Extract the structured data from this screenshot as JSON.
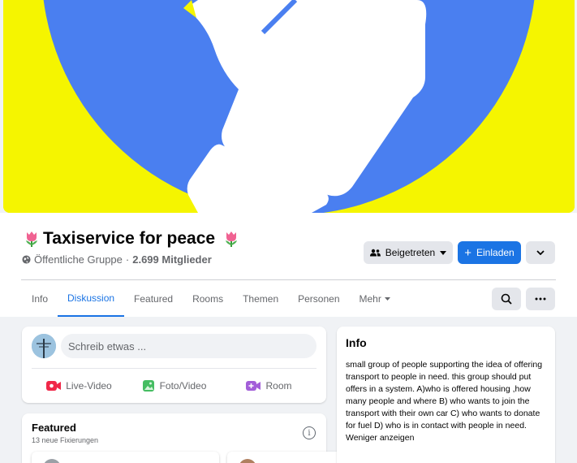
{
  "group": {
    "title": "Taxiservice for peace",
    "privacy": "Öffentliche Gruppe",
    "separator": " · ",
    "members": "2.699 Mitglieder"
  },
  "actions": {
    "joined_label": "Beigetreten",
    "invite_label": "Einladen"
  },
  "tabs": [
    {
      "label": "Info"
    },
    {
      "label": "Diskussion"
    },
    {
      "label": "Featured"
    },
    {
      "label": "Rooms"
    },
    {
      "label": "Themen"
    },
    {
      "label": "Personen"
    },
    {
      "label": "Mehr"
    }
  ],
  "composer": {
    "placeholder": "Schreib etwas ...",
    "actions": [
      {
        "label": "Live-Video",
        "icon": "live-video-icon",
        "color": "#f02849"
      },
      {
        "label": "Foto/Video",
        "icon": "photo-video-icon",
        "color": "#45bd62"
      },
      {
        "label": "Room",
        "icon": "room-icon",
        "color": "#a35fd9"
      }
    ]
  },
  "featured": {
    "title": "Featured",
    "subtitle": "13 neue Fixierungen"
  },
  "info": {
    "title": "Info",
    "description": "small group of people supporting the idea of offering transport to people in need. this group should put offers in a system. A)who is offered housing ,how many people and where B) who wants to join the transport with their own car C) who wants to donate for fuel D) who is in contact with people in need.",
    "more_link": "Weniger anzeigen"
  },
  "colors": {
    "accent": "#1b74e4",
    "cover_yellow": "#f5f500",
    "cover_blue": "#4a7ff0"
  }
}
